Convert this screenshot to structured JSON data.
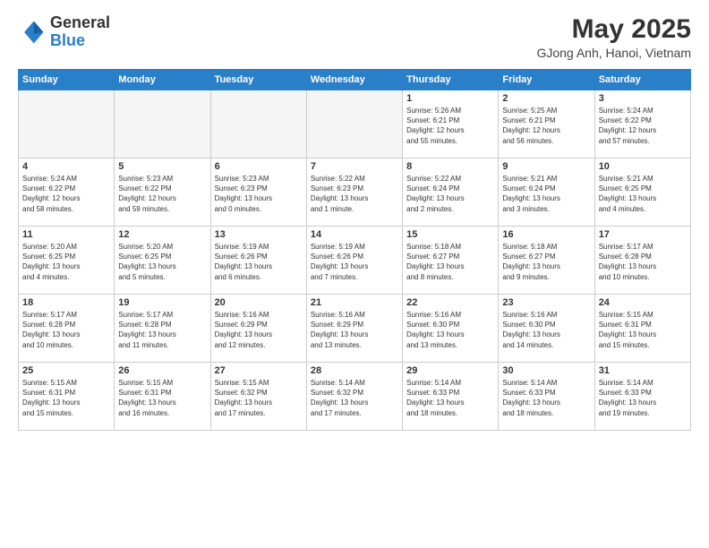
{
  "header": {
    "logo_general": "General",
    "logo_blue": "Blue",
    "main_title": "May 2025",
    "subtitle": "GJong Anh, Hanoi, Vietnam"
  },
  "weekdays": [
    "Sunday",
    "Monday",
    "Tuesday",
    "Wednesday",
    "Thursday",
    "Friday",
    "Saturday"
  ],
  "weeks": [
    [
      {
        "day": "",
        "info": ""
      },
      {
        "day": "",
        "info": ""
      },
      {
        "day": "",
        "info": ""
      },
      {
        "day": "",
        "info": ""
      },
      {
        "day": "1",
        "info": "Sunrise: 5:26 AM\nSunset: 6:21 PM\nDaylight: 12 hours\nand 55 minutes."
      },
      {
        "day": "2",
        "info": "Sunrise: 5:25 AM\nSunset: 6:21 PM\nDaylight: 12 hours\nand 56 minutes."
      },
      {
        "day": "3",
        "info": "Sunrise: 5:24 AM\nSunset: 6:22 PM\nDaylight: 12 hours\nand 57 minutes."
      }
    ],
    [
      {
        "day": "4",
        "info": "Sunrise: 5:24 AM\nSunset: 6:22 PM\nDaylight: 12 hours\nand 58 minutes."
      },
      {
        "day": "5",
        "info": "Sunrise: 5:23 AM\nSunset: 6:22 PM\nDaylight: 12 hours\nand 59 minutes."
      },
      {
        "day": "6",
        "info": "Sunrise: 5:23 AM\nSunset: 6:23 PM\nDaylight: 13 hours\nand 0 minutes."
      },
      {
        "day": "7",
        "info": "Sunrise: 5:22 AM\nSunset: 6:23 PM\nDaylight: 13 hours\nand 1 minute."
      },
      {
        "day": "8",
        "info": "Sunrise: 5:22 AM\nSunset: 6:24 PM\nDaylight: 13 hours\nand 2 minutes."
      },
      {
        "day": "9",
        "info": "Sunrise: 5:21 AM\nSunset: 6:24 PM\nDaylight: 13 hours\nand 3 minutes."
      },
      {
        "day": "10",
        "info": "Sunrise: 5:21 AM\nSunset: 6:25 PM\nDaylight: 13 hours\nand 4 minutes."
      }
    ],
    [
      {
        "day": "11",
        "info": "Sunrise: 5:20 AM\nSunset: 6:25 PM\nDaylight: 13 hours\nand 4 minutes."
      },
      {
        "day": "12",
        "info": "Sunrise: 5:20 AM\nSunset: 6:25 PM\nDaylight: 13 hours\nand 5 minutes."
      },
      {
        "day": "13",
        "info": "Sunrise: 5:19 AM\nSunset: 6:26 PM\nDaylight: 13 hours\nand 6 minutes."
      },
      {
        "day": "14",
        "info": "Sunrise: 5:19 AM\nSunset: 6:26 PM\nDaylight: 13 hours\nand 7 minutes."
      },
      {
        "day": "15",
        "info": "Sunrise: 5:18 AM\nSunset: 6:27 PM\nDaylight: 13 hours\nand 8 minutes."
      },
      {
        "day": "16",
        "info": "Sunrise: 5:18 AM\nSunset: 6:27 PM\nDaylight: 13 hours\nand 9 minutes."
      },
      {
        "day": "17",
        "info": "Sunrise: 5:17 AM\nSunset: 6:28 PM\nDaylight: 13 hours\nand 10 minutes."
      }
    ],
    [
      {
        "day": "18",
        "info": "Sunrise: 5:17 AM\nSunset: 6:28 PM\nDaylight: 13 hours\nand 10 minutes."
      },
      {
        "day": "19",
        "info": "Sunrise: 5:17 AM\nSunset: 6:28 PM\nDaylight: 13 hours\nand 11 minutes."
      },
      {
        "day": "20",
        "info": "Sunrise: 5:16 AM\nSunset: 6:29 PM\nDaylight: 13 hours\nand 12 minutes."
      },
      {
        "day": "21",
        "info": "Sunrise: 5:16 AM\nSunset: 6:29 PM\nDaylight: 13 hours\nand 13 minutes."
      },
      {
        "day": "22",
        "info": "Sunrise: 5:16 AM\nSunset: 6:30 PM\nDaylight: 13 hours\nand 13 minutes."
      },
      {
        "day": "23",
        "info": "Sunrise: 5:16 AM\nSunset: 6:30 PM\nDaylight: 13 hours\nand 14 minutes."
      },
      {
        "day": "24",
        "info": "Sunrise: 5:15 AM\nSunset: 6:31 PM\nDaylight: 13 hours\nand 15 minutes."
      }
    ],
    [
      {
        "day": "25",
        "info": "Sunrise: 5:15 AM\nSunset: 6:31 PM\nDaylight: 13 hours\nand 15 minutes."
      },
      {
        "day": "26",
        "info": "Sunrise: 5:15 AM\nSunset: 6:31 PM\nDaylight: 13 hours\nand 16 minutes."
      },
      {
        "day": "27",
        "info": "Sunrise: 5:15 AM\nSunset: 6:32 PM\nDaylight: 13 hours\nand 17 minutes."
      },
      {
        "day": "28",
        "info": "Sunrise: 5:14 AM\nSunset: 6:32 PM\nDaylight: 13 hours\nand 17 minutes."
      },
      {
        "day": "29",
        "info": "Sunrise: 5:14 AM\nSunset: 6:33 PM\nDaylight: 13 hours\nand 18 minutes."
      },
      {
        "day": "30",
        "info": "Sunrise: 5:14 AM\nSunset: 6:33 PM\nDaylight: 13 hours\nand 18 minutes."
      },
      {
        "day": "31",
        "info": "Sunrise: 5:14 AM\nSunset: 6:33 PM\nDaylight: 13 hours\nand 19 minutes."
      }
    ]
  ]
}
